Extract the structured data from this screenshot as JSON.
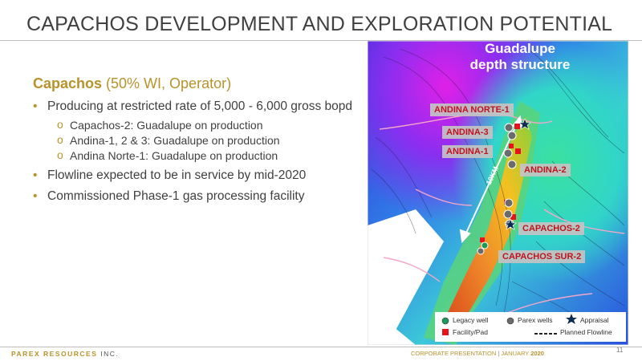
{
  "slide": {
    "title": "CAPACHOS DEVELOPMENT AND EXPLORATION POTENTIAL",
    "page_number": "11"
  },
  "section": {
    "name": "Capachos",
    "interest": " (50% WI, Operator)"
  },
  "bullets": [
    {
      "text": "Producing at restricted rate of 5,000 - 6,000 gross bopd",
      "subs": [
        "Capachos-2: Guadalupe on production",
        "Andina-1, 2 & 3: Guadalupe on production",
        "Andina Norte-1: Guadalupe on production"
      ]
    },
    {
      "text": "Flowline expected to be in service by mid-2020"
    },
    {
      "text": "Commissioned Phase-1 gas processing facility"
    }
  ],
  "map": {
    "title_line1": "Guadalupe",
    "title_line2": "depth structure",
    "scale_label": "10KM",
    "wells": [
      "ANDINA NORTE-1",
      "ANDINA-3",
      "ANDINA-1",
      "ANDINA-2",
      "CAPACHOS-2",
      "CAPACHOS SUR-2"
    ],
    "legend": {
      "legacy_well": "Legacy well",
      "parex_wells": "Parex wells",
      "appraisal": "Appraisal",
      "facility_pad": "Facility/Pad",
      "planned_flowline": "Planned Flowline"
    }
  },
  "footer": {
    "brand": "PAREX RESOURCES",
    "suffix": " INC.",
    "presentation": "CORPORATE PRESENTATION",
    "separator": "|",
    "month": "JANUARY",
    "year": "2020"
  },
  "colors": {
    "accent": "#b8922b",
    "text": "#404040",
    "well_label": "#c0141c"
  }
}
